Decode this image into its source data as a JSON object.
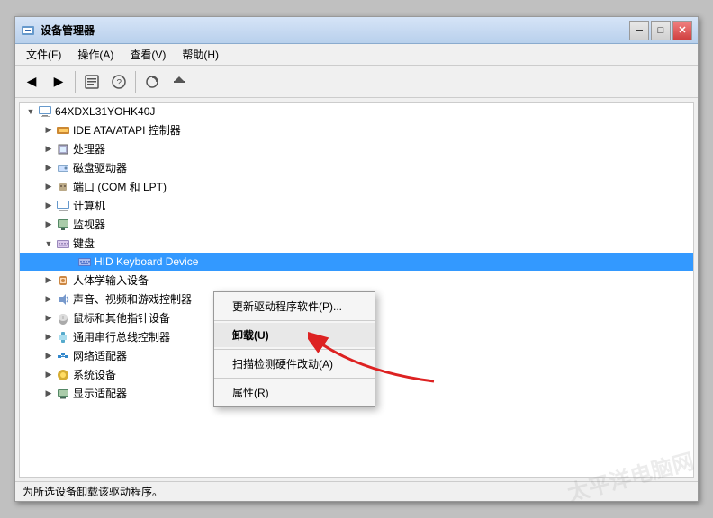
{
  "window": {
    "title": "设备管理器",
    "min_btn": "─",
    "restore_btn": "□",
    "close_btn": "✕"
  },
  "menu": {
    "items": [
      {
        "label": "文件(F)"
      },
      {
        "label": "操作(A)"
      },
      {
        "label": "查看(V)"
      },
      {
        "label": "帮助(H)"
      }
    ]
  },
  "tree": {
    "root": "64XDXL31YOHK40J",
    "nodes": [
      {
        "id": "ide",
        "label": "IDE ATA/ATAPI 控制器",
        "depth": 1,
        "expanded": false,
        "icon": "💾"
      },
      {
        "id": "cpu",
        "label": "处理器",
        "depth": 1,
        "expanded": false,
        "icon": "🔲"
      },
      {
        "id": "disk",
        "label": "磁盘驱动器",
        "depth": 1,
        "expanded": false,
        "icon": "💿"
      },
      {
        "id": "port",
        "label": "端口 (COM 和 LPT)",
        "depth": 1,
        "expanded": false,
        "icon": "🔌"
      },
      {
        "id": "computer",
        "label": "计算机",
        "depth": 1,
        "expanded": false,
        "icon": "🖥"
      },
      {
        "id": "monitor",
        "label": "监视器",
        "depth": 1,
        "expanded": false,
        "icon": "🖥"
      },
      {
        "id": "keyboard",
        "label": "键盘",
        "depth": 1,
        "expanded": true,
        "icon": "⌨"
      },
      {
        "id": "hid",
        "label": "HID Keyboard Device",
        "depth": 2,
        "selected": true,
        "icon": "⌨"
      },
      {
        "id": "human",
        "label": "人体学输入设备",
        "depth": 1,
        "expanded": false,
        "icon": "🖱"
      },
      {
        "id": "sound",
        "label": "声音、视频和游戏控制器",
        "depth": 1,
        "expanded": false,
        "icon": "🔊"
      },
      {
        "id": "mouse",
        "label": "鼠标和其他指针设备",
        "depth": 1,
        "expanded": false,
        "icon": "🖱"
      },
      {
        "id": "com",
        "label": "通用串行总线控制器",
        "depth": 1,
        "expanded": false,
        "icon": "🔌"
      },
      {
        "id": "network",
        "label": "网络适配器",
        "depth": 1,
        "expanded": false,
        "icon": "🌐"
      },
      {
        "id": "system",
        "label": "系统设备",
        "depth": 1,
        "expanded": false,
        "icon": "⚙"
      },
      {
        "id": "display",
        "label": "显示适配器",
        "depth": 1,
        "expanded": false,
        "icon": "🖥"
      }
    ]
  },
  "context_menu": {
    "items": [
      {
        "id": "update",
        "label": "更新驱动程序软件(P)..."
      },
      {
        "id": "uninstall",
        "label": "卸载(U)",
        "highlighted": true
      },
      {
        "id": "scan",
        "label": "扫描检测硬件改动(A)"
      },
      {
        "id": "properties",
        "label": "属性(R)"
      }
    ]
  },
  "status_bar": {
    "text": "为所选设备卸载该驱动程序。"
  },
  "colors": {
    "selected_bg": "#3399ff",
    "hover_bg": "#cce5ff",
    "title_gradient_top": "#d6e4f7",
    "title_gradient_bottom": "#b8d0ec"
  }
}
